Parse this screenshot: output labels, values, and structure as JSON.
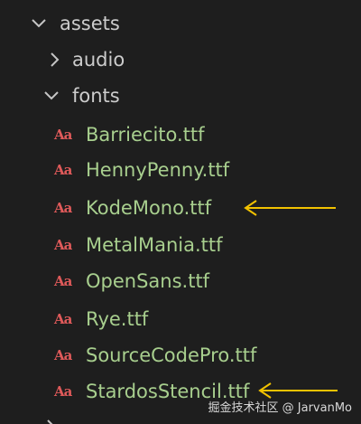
{
  "explorer": {
    "root": {
      "label": "assets",
      "expanded": true
    },
    "audio": {
      "label": "audio",
      "expanded": false
    },
    "fonts": {
      "label": "fonts",
      "expanded": true,
      "files": [
        "Barriecito.ttf",
        "HennyPenny.ttf",
        "KodeMono.ttf",
        "MetalMania.ttf",
        "OpenSans.ttf",
        "Rye.ttf",
        "SourceCodePro.ttf",
        "StardosStencil.ttf"
      ]
    }
  },
  "file_icon": {
    "glyph": "A",
    "icon": "font-file-icon",
    "color": "#e05a5a"
  },
  "annotations": {
    "arrow_color": "#f2c200",
    "arrow_icon": "left-arrow-icon"
  },
  "watermark": "掘金技术社区 @ JarvanMo",
  "colors": {
    "background": "#1e1e1e",
    "folder_text": "#cccccc",
    "file_text": "#a8cf8e"
  }
}
